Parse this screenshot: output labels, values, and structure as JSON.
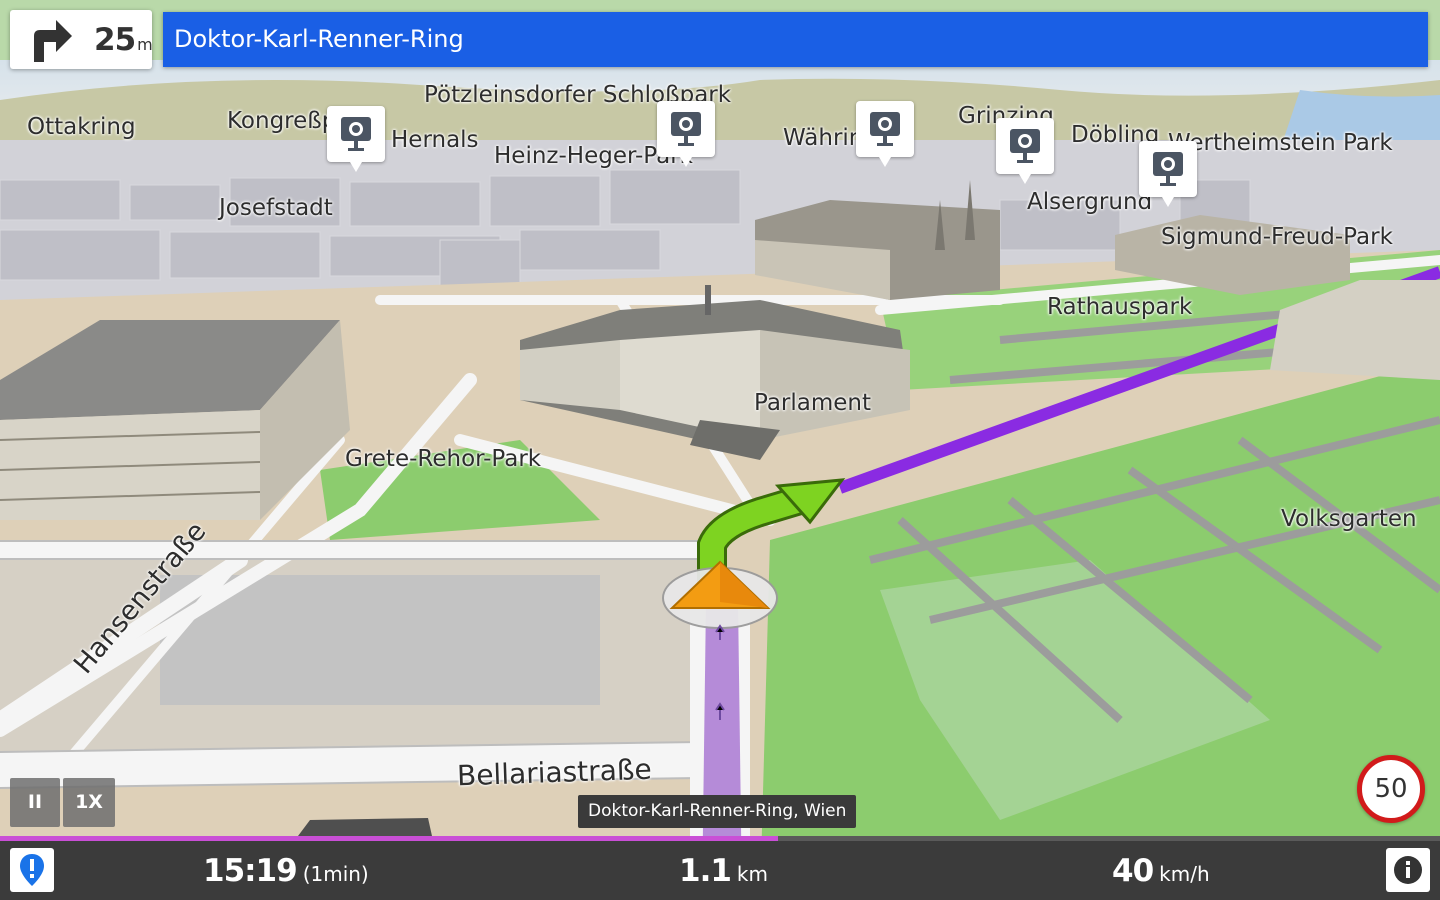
{
  "instruction": {
    "turn_icon": "turn-right-icon",
    "distance": "25",
    "distance_unit": "m",
    "street": "Doktor-Karl-Renner-Ring"
  },
  "map": {
    "labels": {
      "ottakring": "Ottakring",
      "kongresspark": "Kongreßpark",
      "hernals": "Hernals",
      "poetzleinsdorfer": "Pötzleinsdorfer Schloßpark",
      "heinz_heger": "Heinz-Heger-Park",
      "waehring": "Währing",
      "grinzing": "Grinzing",
      "doebling": "Döbling",
      "wertheimstein": "Wertheimstein Park",
      "josefstadt": "Josefstadt",
      "alsergrund": "Alsergrund",
      "sigmund_freud": "Sigmund-Freud-Park",
      "rathauspark": "Rathauspark",
      "parlament": "Parlament",
      "grete_rehor": "Grete-Rehor-Park",
      "volksgarten": "Volksgarten",
      "hansenstrasse": "Hansenstraße",
      "bellariastrasse": "Bellariastraße"
    },
    "route_color": "#8a2be2",
    "maneuver_color": "#7ed321",
    "park_color": "#8ccc6e",
    "road_color": "#8d8d8d"
  },
  "playback": {
    "pause_label": "II",
    "speed_label": "1X"
  },
  "current_location": "Doktor-Karl-Renner-Ring, Wien",
  "speed_limit": "50",
  "trip": {
    "progress": 0.54,
    "arrival_time": "15:19",
    "remaining_time": "(1min)",
    "distance_value": "1.1",
    "distance_unit": "km",
    "speed_value": "40",
    "speed_unit": "km/h"
  },
  "colors": {
    "instruction_bar": "#1a5fe5",
    "progress": "#c94fd6",
    "bottom_bar": "#3b3b3b",
    "speed_limit_ring": "#d11b1b"
  }
}
